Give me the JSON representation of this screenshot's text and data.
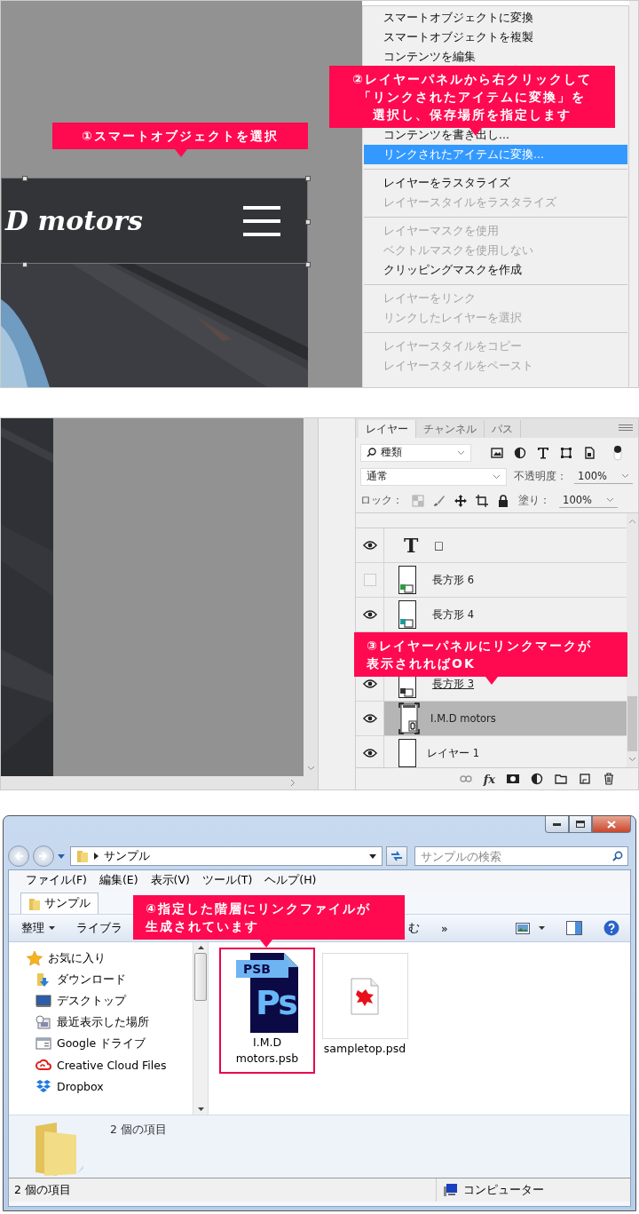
{
  "step1": {
    "logo": "D motors",
    "callout": [
      "①スマートオブジェクトを選択"
    ],
    "menu_callout": [
      "②レイヤーパネルから右クリックして",
      "「リンクされたアイテムに変換」を",
      "選択し、保存場所を指定します"
    ],
    "menu": [
      {
        "kind": "item",
        "label": "スマートオブジェクトに変換",
        "disabled": false,
        "selected": false
      },
      {
        "kind": "item",
        "label": "スマートオブジェクトを複製",
        "disabled": false,
        "selected": false
      },
      {
        "kind": "item",
        "label": "コンテンツを編集",
        "disabled": false,
        "selected": false
      },
      {
        "kind": "item",
        "label": "コンテンツを書き出し...",
        "disabled": false,
        "selected": false
      },
      {
        "kind": "item",
        "label": "リンクされたアイテムに変換...",
        "disabled": false,
        "selected": true
      },
      {
        "kind": "separator"
      },
      {
        "kind": "item",
        "label": "レイヤーをラスタライズ",
        "disabled": false,
        "selected": false
      },
      {
        "kind": "item",
        "label": "レイヤースタイルをラスタライズ",
        "disabled": true,
        "selected": false
      },
      {
        "kind": "separator"
      },
      {
        "kind": "item",
        "label": "レイヤーマスクを使用",
        "disabled": true,
        "selected": false
      },
      {
        "kind": "item",
        "label": "ベクトルマスクを使用しない",
        "disabled": true,
        "selected": false
      },
      {
        "kind": "item",
        "label": "クリッピングマスクを作成",
        "disabled": false,
        "selected": false
      },
      {
        "kind": "separator"
      },
      {
        "kind": "item",
        "label": "レイヤーをリンク",
        "disabled": true,
        "selected": false
      },
      {
        "kind": "item",
        "label": "リンクしたレイヤーを選択",
        "disabled": true,
        "selected": false
      },
      {
        "kind": "separator"
      },
      {
        "kind": "item",
        "label": "レイヤースタイルをコピー",
        "disabled": true,
        "selected": false
      },
      {
        "kind": "item",
        "label": "レイヤースタイルをペースト",
        "disabled": true,
        "selected": false
      }
    ]
  },
  "step2": {
    "tabs": [
      {
        "label": "レイヤー",
        "selected": true
      },
      {
        "label": "チャンネル",
        "selected": false
      },
      {
        "label": "パス",
        "selected": false
      }
    ],
    "filter": "種類",
    "blend_mode": "通常",
    "opacity_label": "不透明度：",
    "opacity": "100%",
    "lock_label": "ロック：",
    "fill_label": "塗り：",
    "fill": "100%",
    "layers": [
      {
        "kind": "text",
        "thumb_label": "T",
        "name": "□",
        "visible": true,
        "selected": false,
        "clipped": false
      },
      {
        "kind": "shape",
        "name": "長方形 6",
        "visible": false,
        "selected": false,
        "clipped": false,
        "color": "#2e9b3e"
      },
      {
        "kind": "shape",
        "name": "長方形 4",
        "visible": true,
        "selected": false,
        "clipped": false,
        "color": "#1c9a98"
      },
      {
        "kind": "shape",
        "name": "長方形 3",
        "visible": true,
        "selected": false,
        "clipped": true,
        "color": "#333333"
      },
      {
        "kind": "linked",
        "name": "I.M.D motors",
        "visible": true,
        "selected": true,
        "clipped": false
      },
      {
        "kind": "pixel",
        "name": "レイヤー 1",
        "visible": true,
        "selected": false,
        "clipped": false
      }
    ],
    "fx_label": "fx",
    "callout": [
      "③レイヤーパネルにリンクマークが",
      "表示されればOK"
    ]
  },
  "step3": {
    "address": "サンプル",
    "search_placeholder": "サンプルの検索",
    "menu": [
      "ファイル(F)",
      "編集(E)",
      "表示(V)",
      "ツール(T)",
      "ヘルプ(H)"
    ],
    "tab": "サンプル",
    "toolbar": [
      {
        "kind": "dropdown",
        "label": "整理"
      },
      {
        "kind": "button",
        "label": "ライブラ"
      },
      {
        "kind": "button",
        "label": "む"
      },
      {
        "kind": "overflow",
        "label": "»"
      }
    ],
    "nav": [
      {
        "kind": "star",
        "label": "お気に入り"
      },
      {
        "kind": "download",
        "label": "ダウンロード"
      },
      {
        "kind": "desktop",
        "label": "デスクトップ"
      },
      {
        "kind": "recent",
        "label": "最近表示した場所"
      },
      {
        "kind": "drive",
        "label": "Google ドライブ"
      },
      {
        "kind": "cloud",
        "label": "Creative Cloud Files"
      },
      {
        "kind": "dropbox",
        "label": "Dropbox"
      }
    ],
    "files": [
      {
        "kind": "psb",
        "name": "I.M.D motors.psb",
        "badge": "PSB",
        "logo": "Ps",
        "highlighted": true
      },
      {
        "kind": "psd",
        "name": "sampletop.psd",
        "highlighted": false
      }
    ],
    "details": "2 個の項目",
    "status": "2 個の項目",
    "zone": "コンピューター",
    "callout": [
      "④指定した階層にリンクファイルが",
      "生成されています"
    ]
  }
}
